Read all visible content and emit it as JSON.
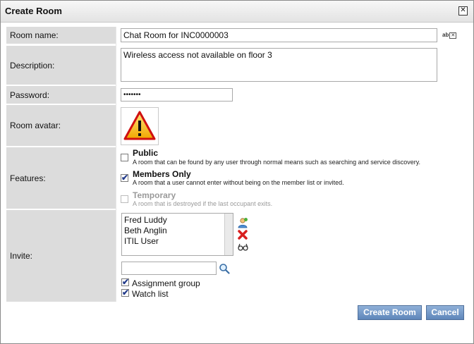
{
  "dialog": {
    "title": "Create Room"
  },
  "labels": {
    "room_name": "Room name:",
    "description": "Description:",
    "password": "Password:",
    "room_avatar": "Room avatar:",
    "features": "Features:",
    "invite": "Invite:"
  },
  "fields": {
    "room_name": "Chat Room for INC0000003",
    "description": "Wireless access not available on floor 3",
    "password": "•••••••",
    "spellcheck_label": "ab",
    "invite_search": ""
  },
  "features": [
    {
      "title": "Public",
      "desc": "A room that can be found by any user through normal means such as searching and service discovery.",
      "checked": false,
      "disabled": false
    },
    {
      "title": "Members Only",
      "desc": "A room that a user cannot enter without being on the member list or invited.",
      "checked": true,
      "disabled": false
    },
    {
      "title": "Temporary",
      "desc": "A room that is destroyed if the last occupant exits.",
      "checked": false,
      "disabled": true
    }
  ],
  "invitees": [
    "Fred Luddy",
    "Beth Anglin",
    "ITIL User"
  ],
  "invite_options": {
    "assignment_group": "Assignment group",
    "watch_list": "Watch list"
  },
  "buttons": {
    "create": "Create Room",
    "cancel": "Cancel"
  },
  "icons": {
    "close": "close-icon",
    "avatar": "warning-icon",
    "add_user": "add-user-icon",
    "remove": "remove-icon",
    "lookup": "glasses-icon",
    "search": "search-icon"
  },
  "colors": {
    "label_bg": "#dcdcdc",
    "button": "#6b92c4",
    "check": "#233b8a",
    "remove": "#d81f1f"
  }
}
